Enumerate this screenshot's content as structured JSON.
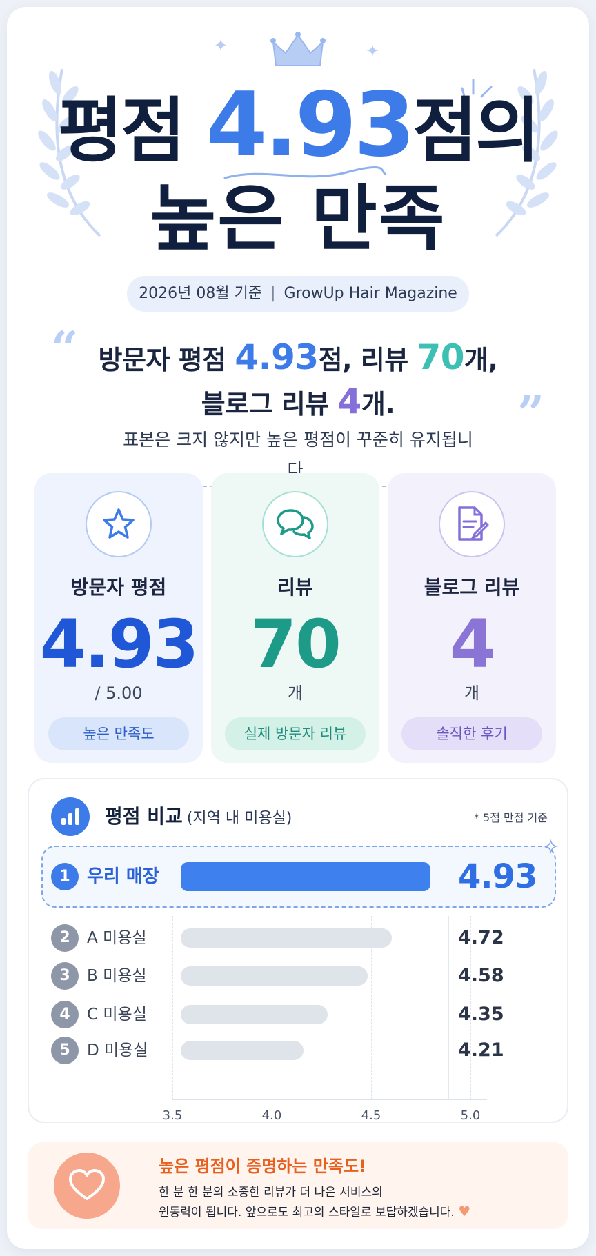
{
  "hero": {
    "title_prefix": "평점",
    "title_number": "4.93",
    "title_suffix": "점의",
    "title_line2": "높은 만족",
    "date_left": "2026년 08월 기준",
    "date_separator": "|",
    "date_right": "GrowUp Hair Magazine"
  },
  "quote": {
    "open_mark": "“",
    "close_mark": "”",
    "line1_a": "방문자 평점 ",
    "rating": "4.93",
    "line1_b": "점, 리뷰 ",
    "reviews": "70",
    "line1_c": "개,",
    "line2_a": "블로그 리뷰 ",
    "blog_reviews": "4",
    "line2_b": "개.",
    "sub": "표본은 크지 않지만 높은 평점이 꾸준히 유지됩니다."
  },
  "cards": [
    {
      "icon": "star-icon",
      "label": "방문자 평점",
      "value": "4.93",
      "unit": "/ 5.00",
      "pill": "높은 만족도",
      "color": "#1f57d6"
    },
    {
      "icon": "chat-bubbles-icon",
      "label": "리뷰",
      "value": "70",
      "unit": "개",
      "pill": "실제 방문자 리뷰",
      "color": "#1e9a88"
    },
    {
      "icon": "document-edit-icon",
      "label": "블로그 리뷰",
      "value": "4",
      "unit": "개",
      "pill": "솔직한 후기",
      "color": "#8a74d6"
    }
  ],
  "compare": {
    "icon": "bar-chart-icon",
    "title": "평점 비교",
    "title_sub": "(지역 내 미용실)",
    "note": "* 5점 만점 기준",
    "rows": [
      {
        "rank": "1",
        "name": "우리 매장",
        "value": "4.93"
      },
      {
        "rank": "2",
        "name": "A 미용실",
        "value": "4.72"
      },
      {
        "rank": "3",
        "name": "B 미용실",
        "value": "4.58"
      },
      {
        "rank": "4",
        "name": "C 미용실",
        "value": "4.35"
      },
      {
        "rank": "5",
        "name": "D 미용실",
        "value": "4.21"
      }
    ],
    "ticks": [
      "3.5",
      "4.0",
      "4.5",
      "5.0"
    ]
  },
  "chart_data": {
    "type": "bar",
    "title": "평점 비교",
    "categories": [
      "우리 매장",
      "A 미용실",
      "B 미용실",
      "C 미용실",
      "D 미용실"
    ],
    "values": [
      4.93,
      4.72,
      4.58,
      4.35,
      4.21
    ],
    "xlim": [
      3.5,
      5.0
    ],
    "x_ticks": [
      "3.5",
      "4.0",
      "4.5",
      "5.0"
    ],
    "orientation": "horizontal"
  },
  "footer": {
    "icon": "heart-icon",
    "title": "높은 평점이 증명하는 만족도!",
    "line1": "한 분 한 분의 소중한 리뷰가 더 나은 서비스의",
    "line2": "원동력이 됩니다. 앞으로도 최고의 스타일로 보답하겠습니다.",
    "heart": "♥"
  },
  "colors": {
    "accent_blue": "#3d7be8",
    "teal": "#3cc0b4",
    "purple": "#8470d8",
    "orange": "#e8601f"
  }
}
